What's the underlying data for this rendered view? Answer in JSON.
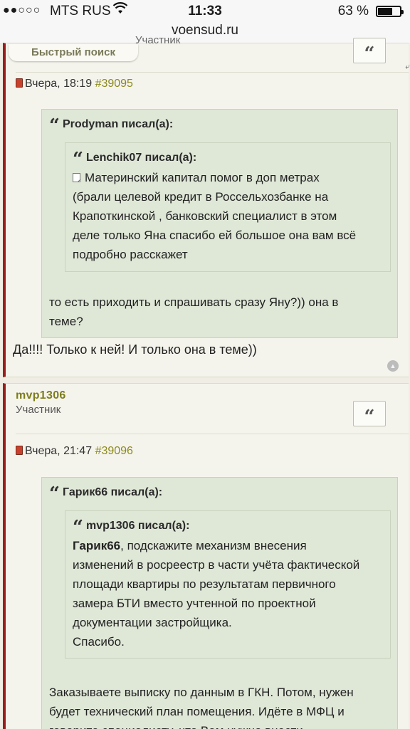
{
  "status_bar": {
    "signal": "●●○○○",
    "carrier": "MTS RUS",
    "time": "11:33",
    "battery": "63 %",
    "battery_level": 0.63
  },
  "browser": {
    "url": "voensud.ru"
  },
  "quick_search": {
    "label": "Быстрый поиск"
  },
  "posts": [
    {
      "partial_role": "Участник",
      "date": "Вчера, 18:19",
      "number": "#39095",
      "quote": {
        "author_head": "Prodyman писал(а):",
        "nested": {
          "author_head": "Lenchik07 писал(а):",
          "lines": [
            "Материнский капитал помог в доп метрах",
            "(брали целевой кредит в Россельхозбанке на",
            "Крапоткинской , банковский специалист в этом",
            "деле только Яна спасибо ей большое она вам всё",
            "подробно расскажет"
          ]
        },
        "lines": [
          "то есть приходить и спрашивать сразу Яну?)) она в",
          "теме?"
        ]
      },
      "text": "Да!!!! Только к ней! И только она в теме))"
    },
    {
      "author": "mvp1306",
      "role": "Участник",
      "date": "Вчера, 21:47",
      "number": "#39096",
      "quote": {
        "author_head": "Гарик66 писал(а):",
        "nested": {
          "author_head": "mvp1306 писал(а):",
          "mention": "Гарик66",
          "first_line_rest": ", подскажите механизм внесения",
          "lines": [
            "изменений в росреестр в части учёта фактической",
            "площади квартиры по результатам первичного",
            "замера БТИ вместо учтенной по проектной",
            "документации застройщика.",
            "Спасибо."
          ]
        },
        "lines": [
          "Заказываете выписку по данным в ГКН. Потом, нужен",
          "будет технический план помещения. Идёте в МФЦ и",
          "говорите специалисту, что Вам нужно внести"
        ]
      }
    }
  ]
}
